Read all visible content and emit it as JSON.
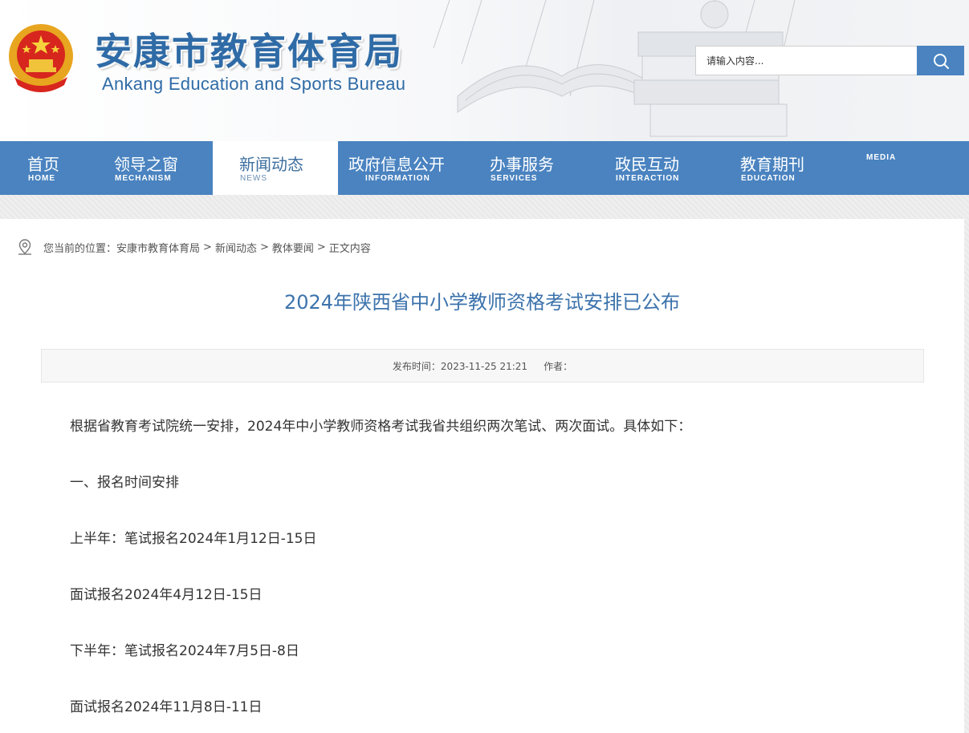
{
  "header": {
    "title_cn": "安康市教育体育局",
    "title_en": "Ankang Education and Sports Bureau",
    "search_placeholder": "请输入内容...",
    "search_icon": "search-icon"
  },
  "nav": {
    "items": [
      {
        "cn": "首页",
        "en": "HOME"
      },
      {
        "cn": "领导之窗",
        "en": "MECHANISM"
      },
      {
        "cn": "新闻动态",
        "en": "NEWS"
      },
      {
        "cn": "政府信息公开",
        "en": "INFORMATION"
      },
      {
        "cn": "办事服务",
        "en": "SERVICES"
      },
      {
        "cn": "政民互动",
        "en": "INTERACTION"
      },
      {
        "cn": "教育期刊",
        "en": "EDUCATION"
      },
      {
        "cn": "",
        "en": "MEDIA"
      }
    ],
    "active": "新闻动态"
  },
  "breadcrumb": {
    "prefix": "您当前的位置：",
    "items": [
      "安康市教育体育局",
      "新闻动态",
      "教体要闻",
      "正文内容"
    ],
    "separator": ">"
  },
  "article": {
    "title": "2024年陕西省中小学教师资格考试安排已公布",
    "publish_label": "发布时间：2023-11-25 21:21",
    "author_label": "作者：",
    "paragraphs": [
      "根据省教育考试院统一安排，2024年中小学教师资格考试我省共组织两次笔试、两次面试。具体如下：",
      "一、报名时间安排",
      "上半年：笔试报名2024年1月12日-15日",
      "面试报名2024年4月12日-15日",
      "下半年：笔试报名2024年7月5日-8日",
      "面试报名2024年11月8日-11日"
    ]
  },
  "colors": {
    "brand_blue": "#4a83c0",
    "title_blue": "#3c73ac"
  }
}
